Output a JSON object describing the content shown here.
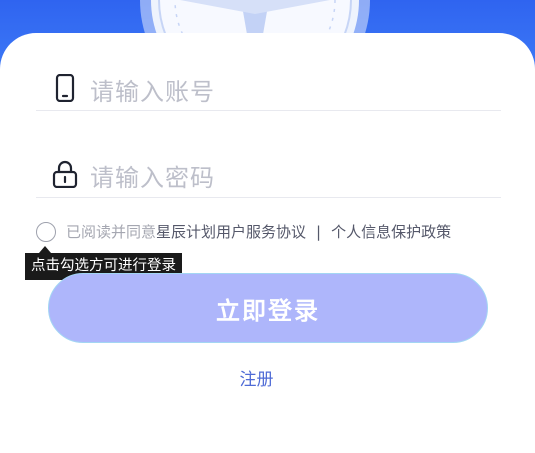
{
  "form": {
    "account_placeholder": "请输入账号",
    "password_placeholder": "请输入密码"
  },
  "agreement": {
    "prefix": "已阅读并同意",
    "terms_link": "星辰计划用户服务协议",
    "separator": "|",
    "privacy_link": "个人信息保护政策"
  },
  "tooltip": {
    "text": "点击勾选方可进行登录"
  },
  "actions": {
    "login_label": "立即登录",
    "register_label": "注册"
  },
  "icons": {
    "account": "phone-icon",
    "password": "lock-icon",
    "banner": "compass-icon"
  },
  "colors": {
    "banner": "#3a72f4",
    "login_button": "#aeb6fb",
    "register_link": "#4f6bd6",
    "tooltip_bg": "#1a1a1a"
  }
}
